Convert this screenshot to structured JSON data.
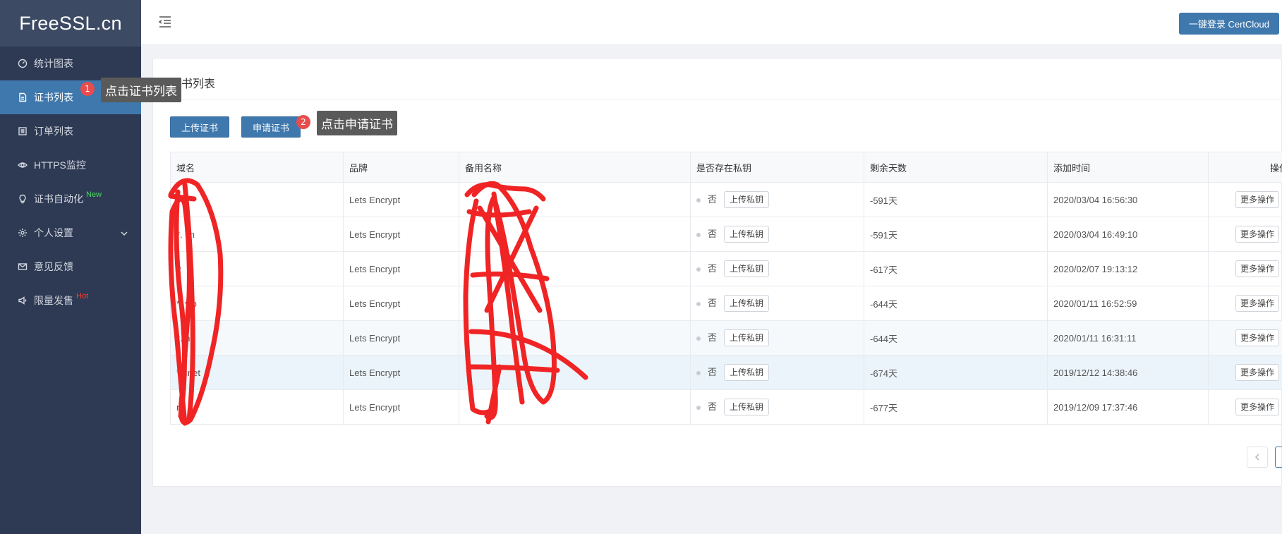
{
  "sidebar": {
    "logo": "FreeSSL.cn",
    "items": [
      {
        "label": "统计图表",
        "icon": "dashboard-icon"
      },
      {
        "label": "证书列表",
        "icon": "document-icon",
        "active": true
      },
      {
        "label": "订单列表",
        "icon": "list-icon"
      },
      {
        "label": "HTTPS监控",
        "icon": "eye-icon"
      },
      {
        "label": "证书自动化",
        "icon": "bulb-icon",
        "sup": "New"
      },
      {
        "label": "个人设置",
        "icon": "gear-icon",
        "expandable": true
      },
      {
        "label": "意见反馈",
        "icon": "mail-icon"
      },
      {
        "label": "限量发售",
        "icon": "megaphone-icon",
        "sup": "Hot"
      }
    ]
  },
  "annotations": {
    "step1_number": "1",
    "step1_text": "点击证书列表",
    "step2_number": "2",
    "step2_text": "点击申请证书"
  },
  "topbar": {
    "login_button": "一键登录 CertCloud"
  },
  "card": {
    "title": "证书列表",
    "upload_button": "上传证书",
    "apply_button": "申请证书"
  },
  "table": {
    "headers": [
      "域名",
      "品牌",
      "备用名称",
      "是否存在私钥",
      "剩余天数",
      "添加时间",
      "操作"
    ],
    "rows": [
      {
        "domain": "",
        "brand": "Lets Encrypt",
        "alt": "",
        "has_key": "否",
        "key_btn": "上传私钥",
        "days": "-591天",
        "added": "2020/03/04 16:56:30",
        "ops": "更多操作"
      },
      {
        "domain": "*.      cn",
        "brand": "Lets Encrypt",
        "alt": "",
        "has_key": "否",
        "key_btn": "上传私钥",
        "days": "-591天",
        "added": "2020/03/04 16:49:10",
        "ops": "更多操作"
      },
      {
        "domain": "y",
        "brand": "Lets Encrypt",
        "alt": "",
        "has_key": "否",
        "key_btn": "上传私钥",
        "days": "-617天",
        "added": "2020/02/07 19:13:12",
        "ops": "更多操作"
      },
      {
        "domain": "*.      vip",
        "brand": "Lets Encrypt",
        "alt": "",
        "has_key": "否",
        "key_btn": "上传私钥",
        "days": "-644天",
        "added": "2020/01/11 16:52:59",
        "ops": "更多操作"
      },
      {
        "domain": "*.      n",
        "brand": "Lets Encrypt",
        "alt": "",
        "has_key": "否",
        "key_btn": "上传私钥",
        "days": "-644天",
        "added": "2020/01/11 16:31:11",
        "ops": "更多操作"
      },
      {
        "domain": "*.      .net",
        "brand": "Lets Encrypt",
        "alt": "",
        "has_key": "否",
        "key_btn": "上传私钥",
        "days": "-674天",
        "added": "2019/12/12 14:38:46",
        "ops": "更多操作"
      },
      {
        "domain": "      n",
        "brand": "Lets Encrypt",
        "alt": "",
        "has_key": "否",
        "key_btn": "上传私钥",
        "days": "-677天",
        "added": "2019/12/09 17:37:46",
        "ops": "更多操作"
      }
    ]
  },
  "colors": {
    "sidebar_bg": "#2e3a53",
    "accent": "#3f78ad",
    "badge": "#e84c4c",
    "scribble": "#f02424"
  }
}
